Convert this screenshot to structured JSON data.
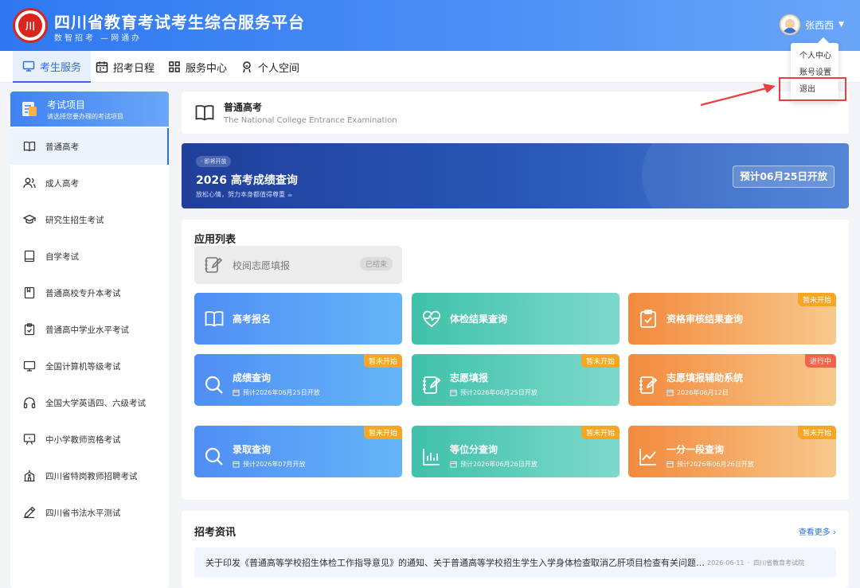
{
  "header": {
    "title": "四川省教育考试考生综合服务平台",
    "subtitle": "数智招考 —网通办",
    "logo_text": "川",
    "user_name": "张西西",
    "caret": "▼"
  },
  "user_menu": {
    "items": [
      "个人中心",
      "账号设置",
      "退出"
    ]
  },
  "nav": {
    "items": [
      {
        "label": "考生服务",
        "icon": "monitor-icon"
      },
      {
        "label": "招考日程",
        "icon": "calendar-icon"
      },
      {
        "label": "服务中心",
        "icon": "grid-icon"
      },
      {
        "label": "个人空间",
        "icon": "user-icon"
      }
    ]
  },
  "sidebar": {
    "title": "考试项目",
    "subtitle": "请选择您要办理的考试项目",
    "items": [
      {
        "label": "普通高考",
        "icon": "book-icon"
      },
      {
        "label": "成人高考",
        "icon": "users-icon"
      },
      {
        "label": "研究生招生考试",
        "icon": "graduation-cap-icon"
      },
      {
        "label": "自学考试",
        "icon": "notebook-icon"
      },
      {
        "label": "普通高校专升本考试",
        "icon": "bookmark-icon"
      },
      {
        "label": "普通高中学业水平考试",
        "icon": "clipboard-icon"
      },
      {
        "label": "全国计算机等级考试",
        "icon": "monitor-icon"
      },
      {
        "label": "全国大学英语四、六级考试",
        "icon": "headphones-icon"
      },
      {
        "label": "中小学教师资格考试",
        "icon": "presentation-icon"
      },
      {
        "label": "四川省特岗教师招聘考试",
        "icon": "school-icon"
      },
      {
        "label": "四川省书法水平测试",
        "icon": "pen-icon"
      }
    ]
  },
  "exam": {
    "name": "普通高考",
    "name_en": "The National College Entrance Examination"
  },
  "banner": {
    "tag": "· 即将开放",
    "title": "2026 高考成绩查询",
    "subtitle": "放松心情，努力本身都值得尊重 ☕",
    "button": "预计06月25日开放"
  },
  "apps": {
    "title": "应用列表",
    "ended": {
      "label": "校阅志愿填报",
      "badge": "已结束"
    },
    "tiles": [
      {
        "label": "高考报名",
        "sub": "",
        "badge": "",
        "badge_type": "",
        "color": "blue",
        "icon": "book-icon"
      },
      {
        "label": "体检结果查询",
        "sub": "",
        "badge": "",
        "badge_type": "",
        "color": "green",
        "icon": "heart-pulse-icon"
      },
      {
        "label": "资格审核结果查询",
        "sub": "",
        "badge": "暂未开始",
        "badge_type": "wait",
        "color": "orange",
        "icon": "clipboard-check-icon"
      },
      {
        "label": "成绩查询",
        "sub": "预计2026年06月25日开放",
        "badge": "暂未开始",
        "badge_type": "wait",
        "color": "blue",
        "icon": "search-icon"
      },
      {
        "label": "志愿填报",
        "sub": "预计2026年06月25日开放",
        "badge": "暂未开始",
        "badge_type": "wait",
        "color": "green",
        "icon": "edit-notebook-icon"
      },
      {
        "label": "志愿填报辅助系统",
        "sub": "2026年06月12日",
        "badge": "进行中",
        "badge_type": "live",
        "color": "orange",
        "icon": "edit-notebook-icon"
      },
      {
        "label": "录取查询",
        "sub": "预计2026年07月开放",
        "badge": "暂未开始",
        "badge_type": "wait",
        "color": "blue",
        "icon": "search-icon"
      },
      {
        "label": "等位分查询",
        "sub": "预计2026年06月26日开放",
        "badge": "暂未开始",
        "badge_type": "wait",
        "color": "green",
        "icon": "bar-chart-icon"
      },
      {
        "label": "一分一段查询",
        "sub": "预计2026年06月26日开放",
        "badge": "暂未开始",
        "badge_type": "wait",
        "color": "orange",
        "icon": "line-chart-icon"
      }
    ]
  },
  "news": {
    "title": "招考资讯",
    "more": "查看更多 ›",
    "items": [
      {
        "text": "关于印发《普通高等学校招生体检工作指导意见》的通知、关于普通高等学校招生学生入学身体检查取消乙肝项目检查有关问题的通知",
        "date": "2026-06-11",
        "source": "四川省教育考试院"
      }
    ]
  },
  "colors": {
    "primary": "#2f6fe0",
    "wait_badge": "#f5a623",
    "live_badge": "#f2644a",
    "highlight": "#e64040"
  }
}
